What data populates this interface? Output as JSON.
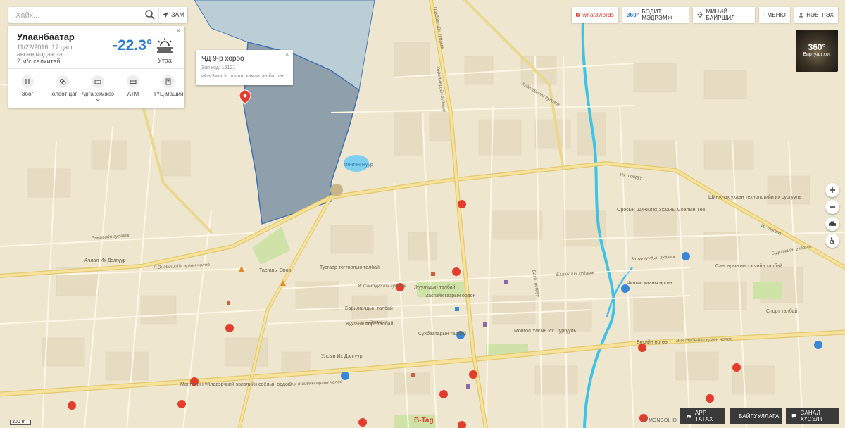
{
  "search": {
    "placeholder": "Хайх...",
    "route_label": "ЗАМ"
  },
  "weather": {
    "city": "Улаанбаатар",
    "date": "11/22/2016, 17 цагт",
    "note": "авсан мэдээгээр",
    "wind": "2 м/с салхитай.",
    "temperature": "-22.3°",
    "condition": "Утаа",
    "close": "×",
    "categories": [
      {
        "label": "Зоог",
        "icon": "fork-knife-icon"
      },
      {
        "label": "Чөлөөт цаг",
        "icon": "leisure-icon"
      },
      {
        "label": "Арга хэмжээ",
        "icon": "ticket-icon"
      },
      {
        "label": "ATM",
        "icon": "atm-card-icon"
      },
      {
        "label": "ТҮЦ машин",
        "icon": "kiosk-machine-icon"
      }
    ]
  },
  "popup": {
    "title": "ЧД 9-р хороо",
    "zip": "Зип код: 15121",
    "w3w": "what3words: жишиг.хамаатан.батлан",
    "close": "×"
  },
  "topbar": {
    "w3w": "what3words",
    "view360_badge": "360°",
    "view360": "БОДИТ МЭДРЭМЖ",
    "my_location": "МИНИЙ БАЙРШИЛ",
    "menu": "МЕНЮ",
    "login": "НЭВТРЭХ"
  },
  "tile360": {
    "big": "360°",
    "small": "Виртуал хот"
  },
  "bottombar": {
    "app": "APP ТАТАХ",
    "org": "БАЙГУУЛЛАГА",
    "feedback": "САНАЛ ХҮСЭЛТ"
  },
  "scale": "300 m",
  "copyright": "© MONGOL ID",
  "map_labels": {
    "lake": "Мөнгөн Нуур",
    "zaisan": "Засгийн газрын ордон",
    "zhuulchin": "Жуулчдын талбай",
    "barilgachin": "Барилгачдын талбай",
    "sport": "Спорт талбай",
    "sport2": "Спорт талбай",
    "sukhbaatar": "Сүхбаатарын талбай",
    "ulsiin_ikh": "Улсын Их Дэлгүүр",
    "achlal": "Ачлал Их Дэлгүүр",
    "tsagaan_ovoo": "Тасганы Овоо",
    "tusgaar": "Тусгаар тогтнолын талбай",
    "university": "Шинжлэх ухаан технологийн их сургууль",
    "academy": "Оросын Шинжлэх Ухааны Соёлын Төв",
    "mongol_univ": "Монгол Улсын Их Сургууль",
    "sansar": "Сансарын нисгэгчийн талбай",
    "b_tag": "B-Tag",
    "mongol_uildver": "Монголын үйлдвэрчний эвлэлийн соёлын ордон",
    "ikh_toiruu": "Их тойруу",
    "ikh_toiruu2": "Их тойруу",
    "enkh_taivan": "Энх тайвны өргөн чөлөө",
    "enkh_taivan2": "Энх тайваны өргөн чөлөө",
    "bokh_urgoo": "Бөхийн өргөө",
    "zaluuchuud": "Залуучуудын гудамж",
    "baga_toiruu": "Бага тойруу",
    "zhamsranjav": "Ж.Самбуугийн гудамж",
    "gudamj_t": "Л.Энэбишийн өргөн чөлөө",
    "chingis": "Чингис хааны өргөө",
    "tsagdaa": "Цагдаагийн гудамж",
    "dorj": "Б.Доржийн гудамж",
    "khudaldaa": "Худалдааны гудамж",
    "partizan": "Хөдөлмөрийн гудамж",
    "baazh": "Бааэжийн гудамж",
    "zhuulchny": "Жуулчны гудамж",
    "energy": "Энергийн гудамж"
  }
}
